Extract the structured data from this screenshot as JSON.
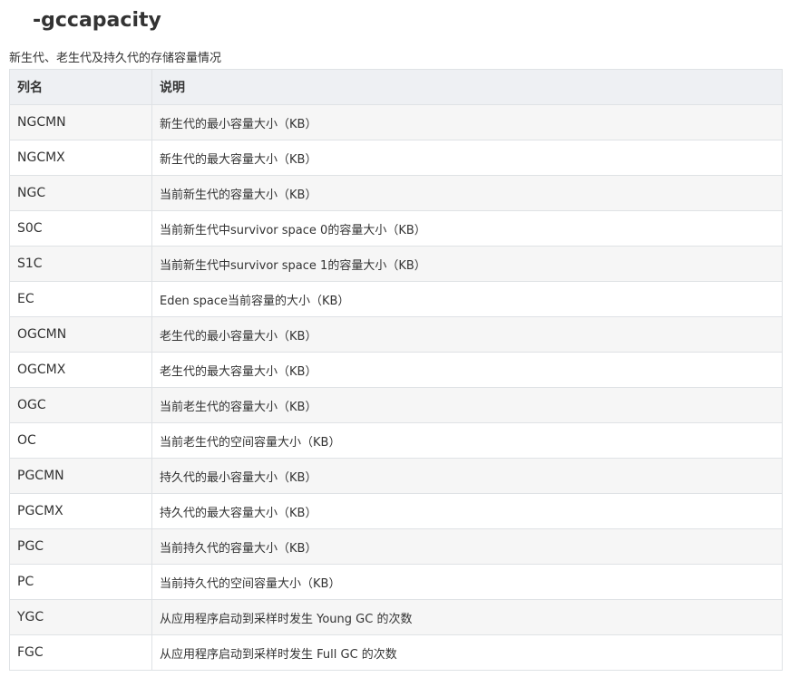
{
  "title": "-gccapacity",
  "subtitle": "新生代、老生代及持久代的存储容量情况",
  "table": {
    "headers": [
      "列名",
      "说明"
    ],
    "rows": [
      {
        "name": "NGCMN",
        "desc": "新生代的最小容量大小（KB）"
      },
      {
        "name": "NGCMX",
        "desc": "新生代的最大容量大小（KB）"
      },
      {
        "name": "NGC",
        "desc": "当前新生代的容量大小（KB）"
      },
      {
        "name": "S0C",
        "desc": "当前新生代中survivor space 0的容量大小（KB）"
      },
      {
        "name": "S1C",
        "desc": "当前新生代中survivor space 1的容量大小（KB）"
      },
      {
        "name": "EC",
        "desc": "Eden space当前容量的大小（KB）"
      },
      {
        "name": "OGCMN",
        "desc": "老生代的最小容量大小（KB）"
      },
      {
        "name": "OGCMX",
        "desc": "老生代的最大容量大小（KB）"
      },
      {
        "name": "OGC",
        "desc": "当前老生代的容量大小（KB）"
      },
      {
        "name": "OC",
        "desc": "当前老生代的空间容量大小（KB）"
      },
      {
        "name": "PGCMN",
        "desc": "持久代的最小容量大小（KB）"
      },
      {
        "name": "PGCMX",
        "desc": "持久代的最大容量大小（KB）"
      },
      {
        "name": "PGC",
        "desc": "当前持久代的容量大小（KB）"
      },
      {
        "name": "PC",
        "desc": "当前持久代的空间容量大小（KB）"
      },
      {
        "name": "YGC",
        "desc": "从应用程序启动到采样时发生 Young GC 的次数"
      },
      {
        "name": "FGC",
        "desc": "从应用程序启动到采样时发生 Full GC 的次数"
      }
    ]
  }
}
